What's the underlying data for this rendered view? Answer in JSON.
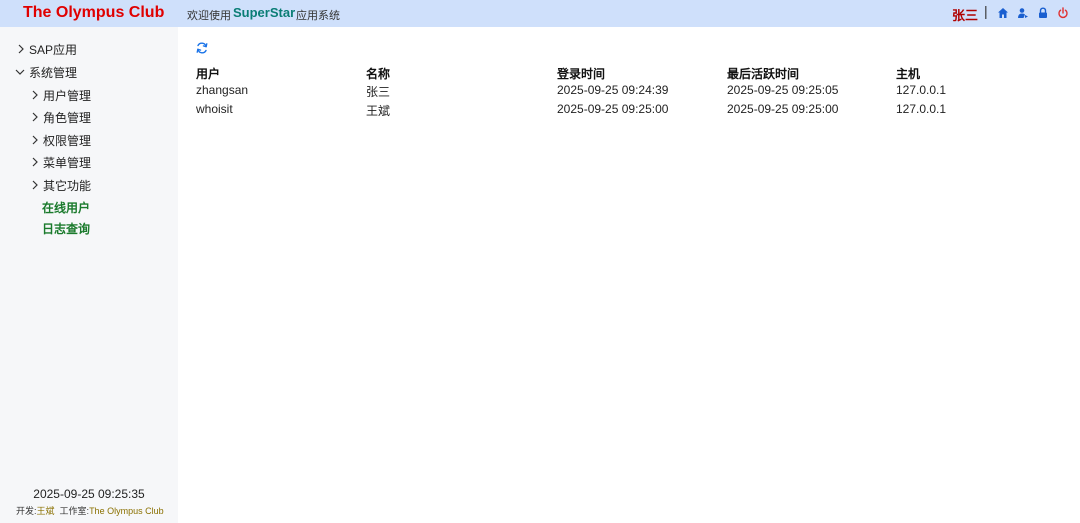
{
  "header": {
    "brand": "The Olympus Club",
    "welcome": "欢迎使用",
    "product": "SuperStar",
    "app_system": "应用系统",
    "username": "张三",
    "separator": "|",
    "icons": [
      "home-icon",
      "user-switch-icon",
      "lock-icon",
      "power-icon"
    ],
    "colors": {
      "bar": "#cfe0fb",
      "brand": "#e00000",
      "product": "#0a7d75",
      "username": "#b00000",
      "icon": "#1a5fd0",
      "power": "#e03030"
    }
  },
  "sidebar": {
    "items": [
      {
        "label": "SAP应用",
        "chevron": "right"
      },
      {
        "label": "系统管理",
        "chevron": "down"
      },
      {
        "label": "用户管理",
        "chevron": "right"
      },
      {
        "label": "角色管理",
        "chevron": "right"
      },
      {
        "label": "权限管理",
        "chevron": "right"
      },
      {
        "label": "菜单管理",
        "chevron": "right"
      },
      {
        "label": "其它功能",
        "chevron": "right"
      },
      {
        "label": "在线用户",
        "chevron": "none",
        "active": true
      },
      {
        "label": "日志查询",
        "chevron": "none",
        "active": true
      }
    ],
    "datetime": "2025-09-25 09:25:35",
    "credit": {
      "dev_label": "开发:",
      "dev_name": "王斌",
      "studio_label": "工作室:",
      "studio_name": "The Olympus Club"
    }
  },
  "main": {
    "refresh_icon": "refresh-icon",
    "columns": [
      "用户",
      "名称",
      "登录时间",
      "最后活跃时间",
      "主机"
    ],
    "rows": [
      [
        "zhangsan",
        "张三",
        "2025-09-25 09:24:39",
        "2025-09-25 09:25:05",
        "127.0.0.1"
      ],
      [
        "whoisit",
        "王斌",
        "2025-09-25 09:25:00",
        "2025-09-25 09:25:00",
        "127.0.0.1"
      ]
    ]
  }
}
